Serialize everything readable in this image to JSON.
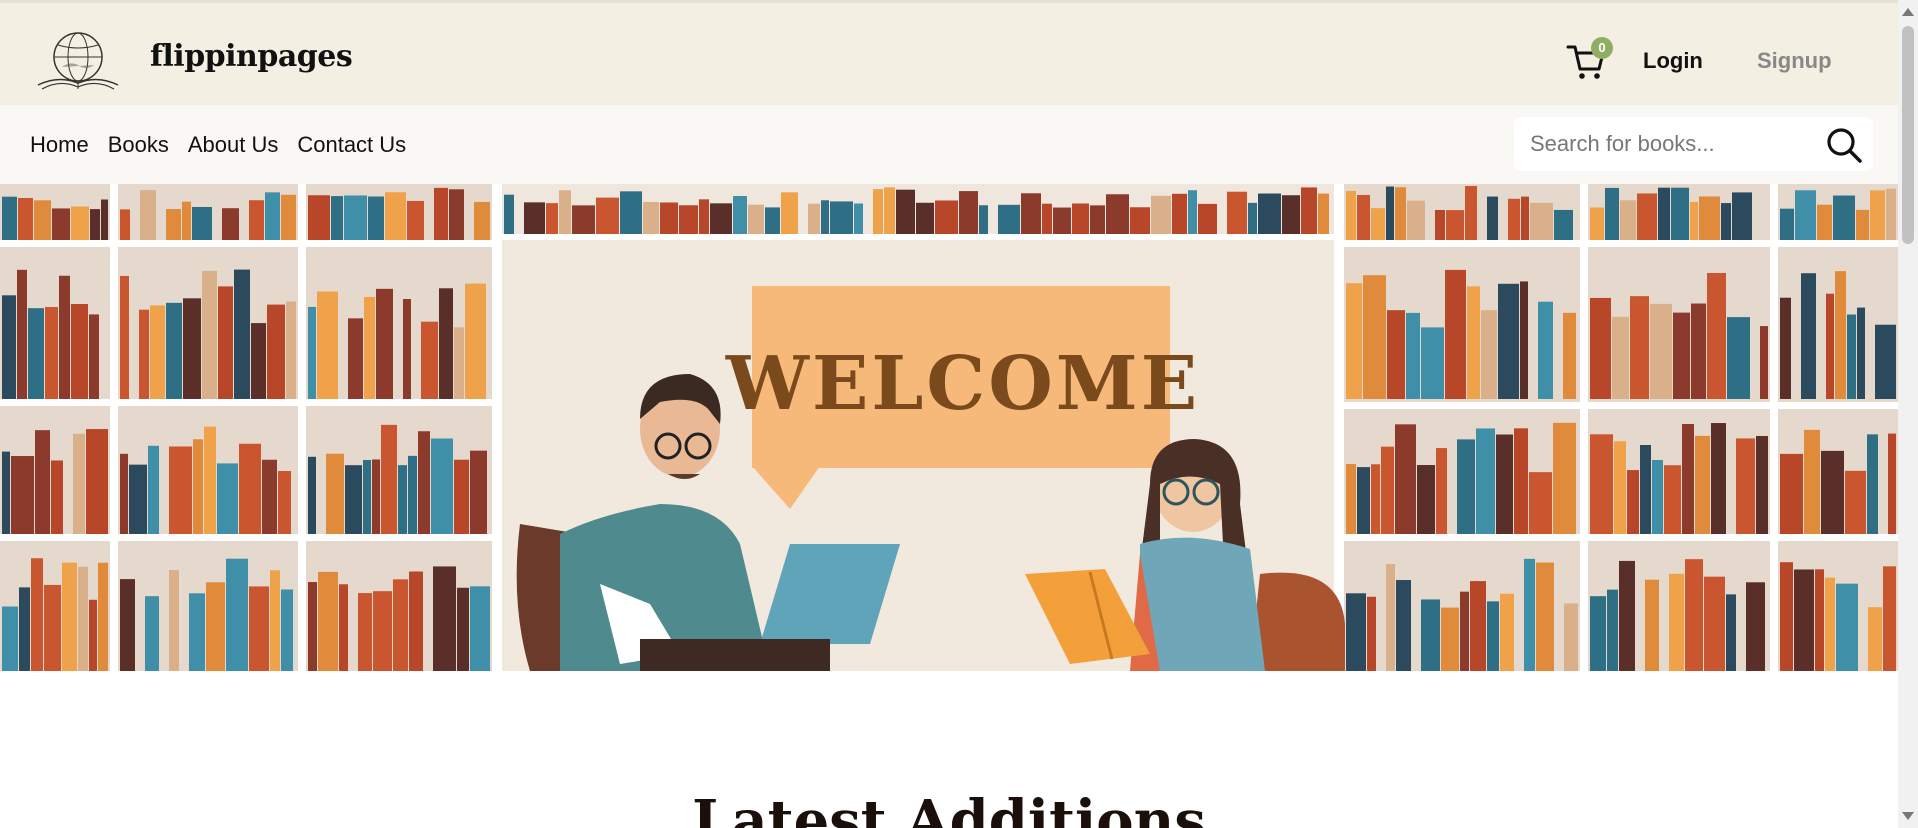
{
  "header": {
    "brand": "flippinpages",
    "cart_count": "0",
    "login_label": "Login",
    "signup_label": "Signup"
  },
  "nav": {
    "items": [
      "Home",
      "Books",
      "About Us",
      "Contact Us"
    ]
  },
  "search": {
    "placeholder": "Search for books..."
  },
  "hero": {
    "banner_text": "WELCOME"
  },
  "main": {
    "section_title": "Latest Additions"
  },
  "colors": {
    "header_bg": "#f3efe3",
    "nav_bg": "#f9f8f4",
    "badge": "#8fae62",
    "welcome_sign": "#f6b97a",
    "welcome_text": "#7a4a1c"
  },
  "icons": [
    "globe-book-logo-icon",
    "cart-icon",
    "search-icon"
  ]
}
